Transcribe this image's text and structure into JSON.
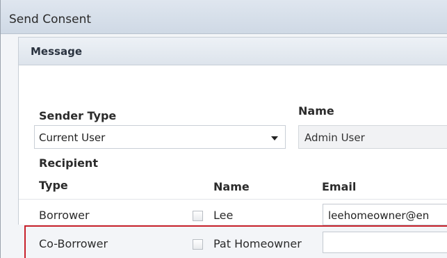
{
  "window": {
    "title": "Send Consent"
  },
  "message_section": {
    "header": "Message",
    "sender_type_label": "Sender Type",
    "sender_type_value": "Current User",
    "name_label": "Name",
    "name_value": "Admin User",
    "recipient_type_label_line1": "Recipient",
    "recipient_type_label_line2": "Type",
    "recipient_name_header": "Name",
    "recipient_email_header": "Email",
    "recipients": [
      {
        "type": "Borrower",
        "name": "Lee",
        "email": "leehomeowner@en",
        "checked": false
      },
      {
        "type": "Co-Borrower",
        "name": "Pat Homeowner",
        "email": "",
        "checked": false
      }
    ]
  },
  "colors": {
    "highlight_border": "#c8202a",
    "title_bar": "#dfe6ef",
    "panel_header": "#edf1f6"
  }
}
